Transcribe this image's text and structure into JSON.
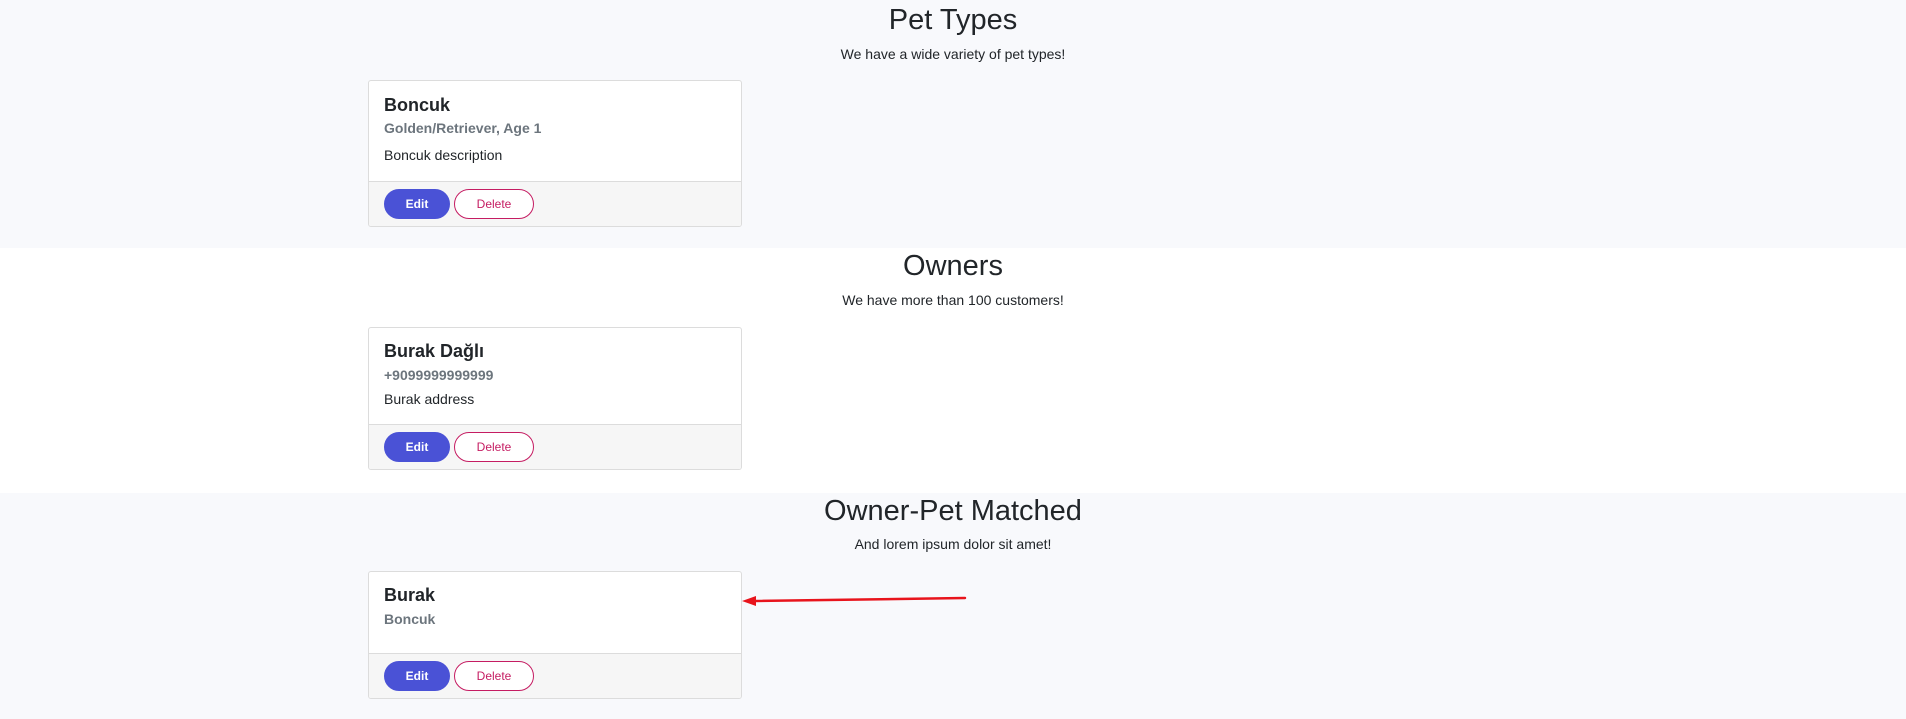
{
  "sections": {
    "pet_types": {
      "title": "Pet Types",
      "subtitle": "We have a wide variety of pet types!",
      "card": {
        "title": "Boncuk",
        "subtitle": "Golden/Retriever, Age 1",
        "text": "Boncuk description",
        "edit_label": "Edit",
        "delete_label": "Delete"
      }
    },
    "owners": {
      "title": "Owners",
      "subtitle": "We have more than 100 customers!",
      "card": {
        "title": "Burak Dağlı",
        "subtitle": "+9099999999999",
        "text": "Burak address",
        "edit_label": "Edit",
        "delete_label": "Delete"
      }
    },
    "matched": {
      "title": "Owner-Pet Matched",
      "subtitle": "And lorem ipsum dolor sit amet!",
      "card": {
        "title": "Burak",
        "subtitle": "Boncuk",
        "edit_label": "Edit",
        "delete_label": "Delete"
      }
    }
  },
  "colors": {
    "primary": "#4a52d6",
    "danger": "#c51c62",
    "section_alt_bg": "#f8f9fc",
    "annotation_arrow": "#e8141c"
  },
  "icons": {
    "annotation": "arrow-left-icon"
  }
}
